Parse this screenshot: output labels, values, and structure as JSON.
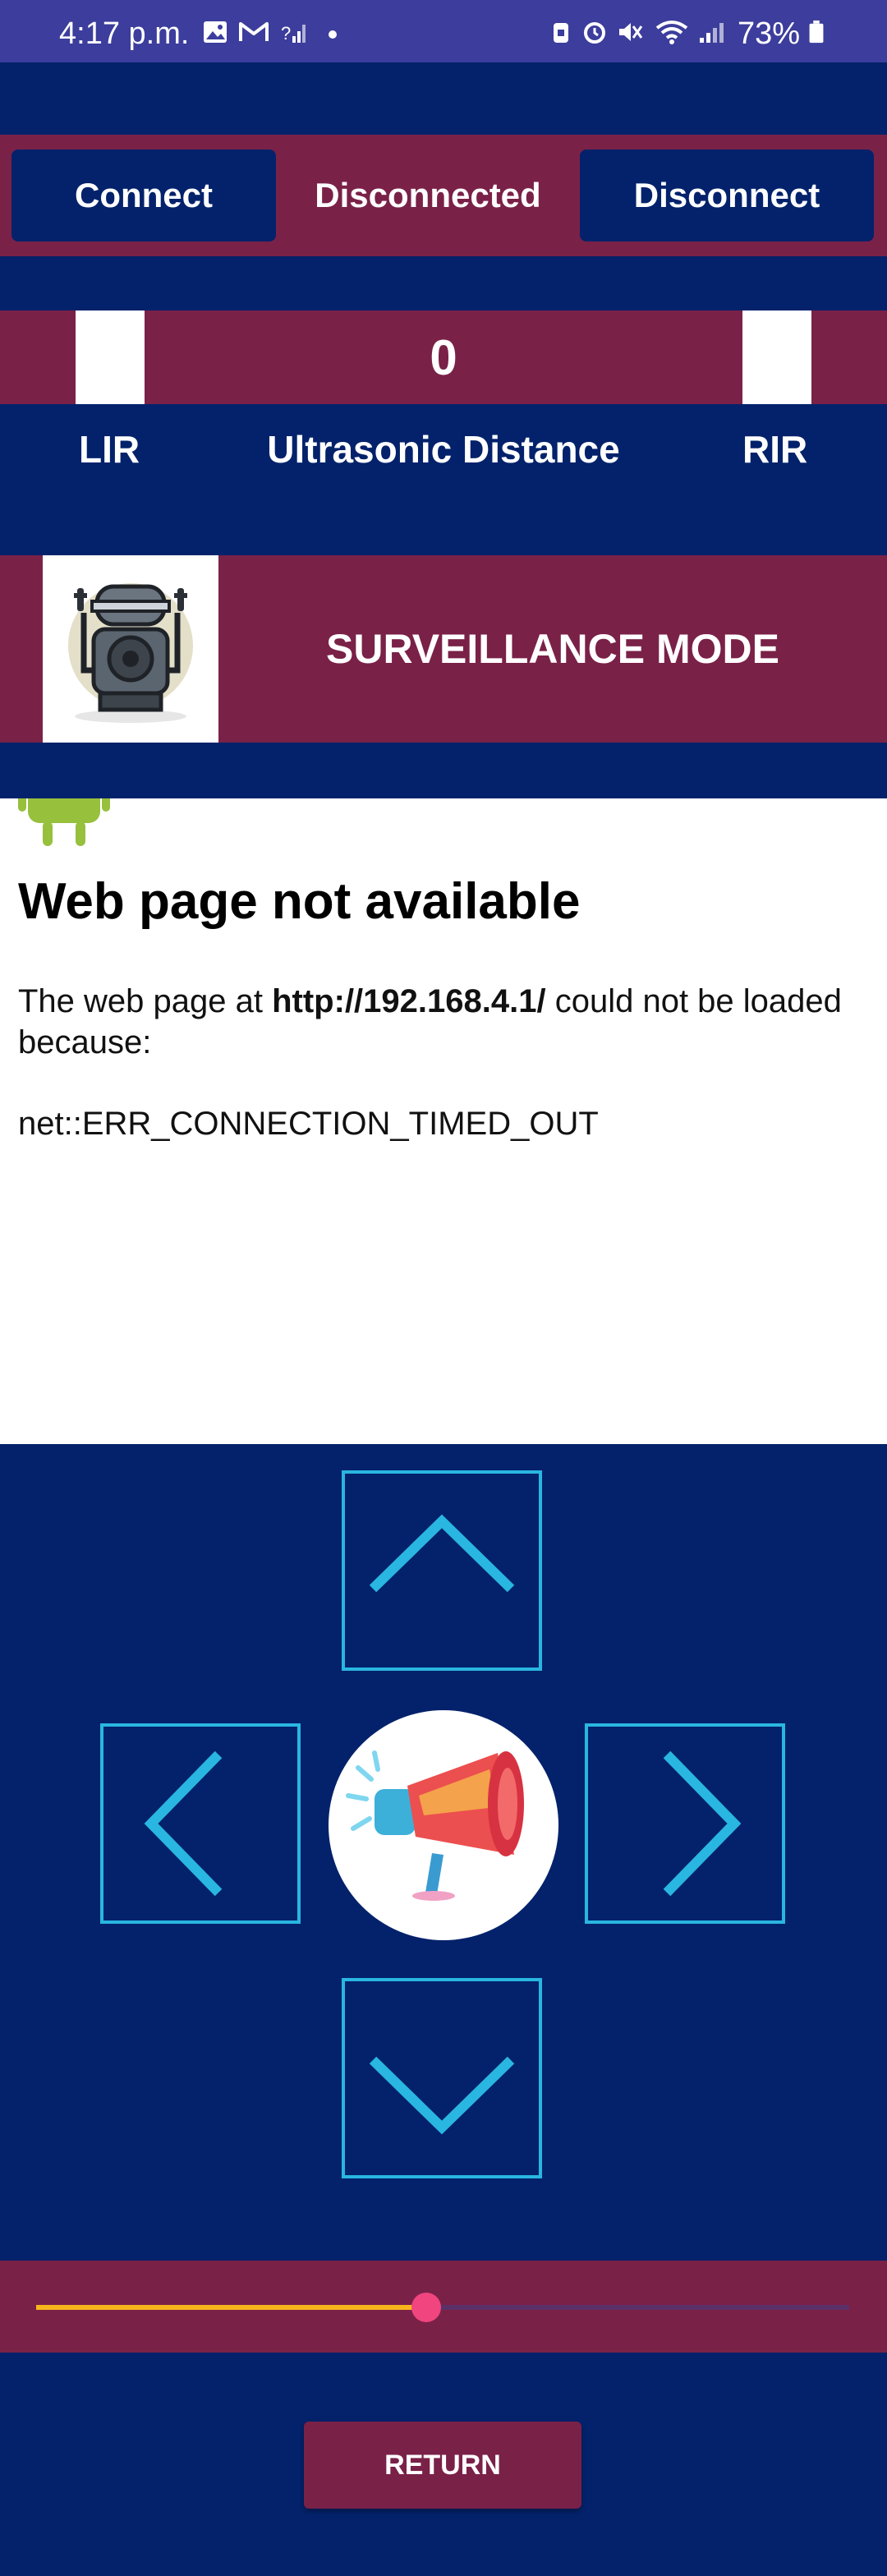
{
  "status_bar": {
    "time": "4:17 p.m.",
    "battery": "73%",
    "icons": [
      "image-icon",
      "gmail-icon",
      "signal-question-icon",
      "dot-icon",
      "lock-icon",
      "alarm-icon",
      "mute-icon",
      "wifi-icon",
      "signal-icon",
      "battery-icon"
    ]
  },
  "connection": {
    "connect_label": "Connect",
    "status_text": "Disconnected",
    "disconnect_label": "Disconnect"
  },
  "sensors": {
    "distance_value": "0",
    "lir_label": "LIR",
    "distance_label": "Ultrasonic Distance",
    "rir_label": "RIR"
  },
  "mode": {
    "title": "SURVEILLANCE MODE",
    "image": "robot-icon"
  },
  "webview": {
    "title": "Web page not available",
    "body_prefix": "The web page at ",
    "url": "http://192.168.4.1/",
    "body_suffix": " could not be loaded because:",
    "error": "net::ERR_CONNECTION_TIMED_OUT"
  },
  "controls": {
    "up": "chevron-up-icon",
    "left": "chevron-left-icon",
    "right": "chevron-right-icon",
    "down": "chevron-down-icon",
    "horn": "megaphone-icon"
  },
  "slider": {
    "value_fraction": 0.48,
    "track_color": "#5b3068",
    "fill_color": "#f7b51c",
    "thumb_color": "#f0457e"
  },
  "return_label": "RETURN",
  "colors": {
    "background": "#03226b",
    "accent": "#7a2148",
    "arrow": "#29b6e0",
    "status_bar": "#3c3d9c"
  }
}
